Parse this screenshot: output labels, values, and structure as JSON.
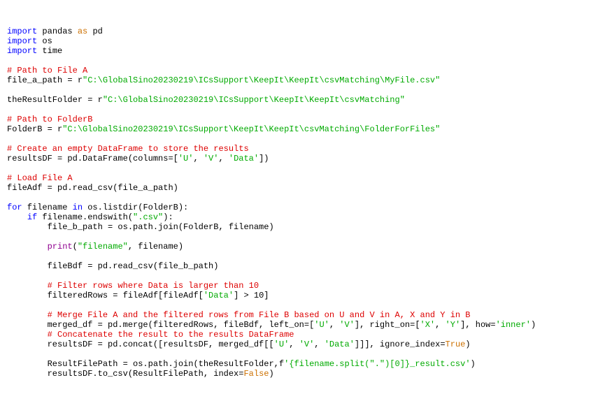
{
  "code": {
    "l1": {
      "imp": "import",
      "pkg": "pandas",
      "as": "as",
      "alias": "pd"
    },
    "l2": {
      "imp": "import",
      "pkg": "os"
    },
    "l3": {
      "imp": "import",
      "pkg": "time"
    },
    "l5": "# Path to File A",
    "l6": {
      "lhs": "file_a_path = r",
      "str": "\"C:\\GlobalSino20230219\\ICsSupport\\KeepIt\\KeepIt\\csvMatching\\MyFile.csv\""
    },
    "l8": {
      "lhs": "theResultFolder = r",
      "str": "\"C:\\GlobalSino20230219\\ICsSupport\\KeepIt\\KeepIt\\csvMatching\""
    },
    "l10": "# Path to FolderB",
    "l11": {
      "lhs": "FolderB = r",
      "str": "\"C:\\GlobalSino20230219\\ICsSupport\\KeepIt\\KeepIt\\csvMatching\\FolderForFiles\""
    },
    "l13": "# Create an empty DataFrame to store the results",
    "l14": {
      "a": "resultsDF = pd.DataFrame(columns=[",
      "s1": "'U'",
      "c1": ", ",
      "s2": "'V'",
      "c2": ", ",
      "s3": "'Data'",
      "b": "])"
    },
    "l16": "# Load File A",
    "l17": "fileAdf = pd.read_csv(file_a_path)",
    "l19": {
      "for": "for",
      "a": " filename ",
      "in": "in",
      "b": " os.listdir(FolderB):"
    },
    "l20": {
      "if": "if",
      "a": " filename.endswith(",
      "s": "\".csv\"",
      "b": "):"
    },
    "l21": "        file_b_path = os.path.join(FolderB, filename)",
    "l23": {
      "prn": "print",
      "a": "(",
      "s": "\"filename\"",
      "b": ", filename)"
    },
    "l25": "        fileBdf = pd.read_csv(file_b_path)",
    "l27": "        # Filter rows where Data is larger than 10",
    "l28": {
      "a": "        filteredRows = fileAdf[fileAdf[",
      "s": "'Data'",
      "b": "] > 10]"
    },
    "l30": "        # Merge File A and the filtered rows from File B based on U and V in A, X and Y in B",
    "l31": {
      "a": "        merged_df = pd.merge(filteredRows, fileBdf, left_on=[",
      "s1": "'U'",
      "c1": ", ",
      "s2": "'V'",
      "b": "], right_on=[",
      "s3": "'X'",
      "c2": ", ",
      "s4": "'Y'",
      "d": "], how=",
      "s5": "'inner'",
      "e": ")"
    },
    "l32": "        # Concatenate the result to the results DataFrame",
    "l33": {
      "a": "        resultsDF = pd.concat([resultsDF, merged_df[[",
      "s1": "'U'",
      "c1": ", ",
      "s2": "'V'",
      "c2": ", ",
      "s3": "'Data'",
      "b": "]]], ignore_index=",
      "t": "True",
      "e": ")"
    },
    "l35": {
      "a": "        ResultFilePath = os.path.join(theResultFolder,f",
      "s": "'{filename.split(\".\")[0]}_result.csv'",
      "b": ")"
    },
    "l36": {
      "a": "        resultsDF.to_csv(ResultFilePath, index=",
      "f": "False",
      "b": ")"
    }
  }
}
